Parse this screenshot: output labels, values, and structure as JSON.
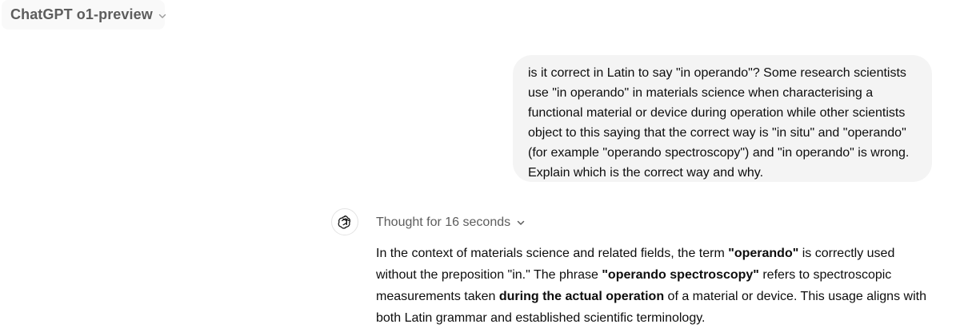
{
  "header": {
    "model_name": "ChatGPT o1-preview",
    "dropdown_icon": "chevron-down-icon"
  },
  "user_message": {
    "text": "is it correct in Latin to say \"in operando\"? Some research scientists use \"in operando\" in materials science when characterising a functional material or device during operation while other scientists object to this saying that the correct way is \"in situ\" and \"operando\" (for example \"operando spectroscopy\") and \"in operando\" is wrong. Explain which is the correct way and why."
  },
  "assistant": {
    "avatar_icon": "openai-logo-icon",
    "thought_label": "Thought for 16 seconds",
    "thought_toggle_icon": "chevron-down-icon",
    "response": {
      "seg1": "In the context of materials science and related fields, the term ",
      "bold1": "\"operando\"",
      "seg2": " is correctly used without the preposition \"in.\" The phrase ",
      "bold2": "\"operando spectroscopy\"",
      "seg3": " refers to spectroscopic measurements taken ",
      "bold3": "during the actual operation",
      "seg4": " of a material or device. This usage aligns with both Latin grammar and established scientific terminology."
    }
  },
  "colors": {
    "user_bubble_bg": "#f4f4f4",
    "secondary_text": "#5d5d5d",
    "primary_text": "#0d0d0d"
  }
}
